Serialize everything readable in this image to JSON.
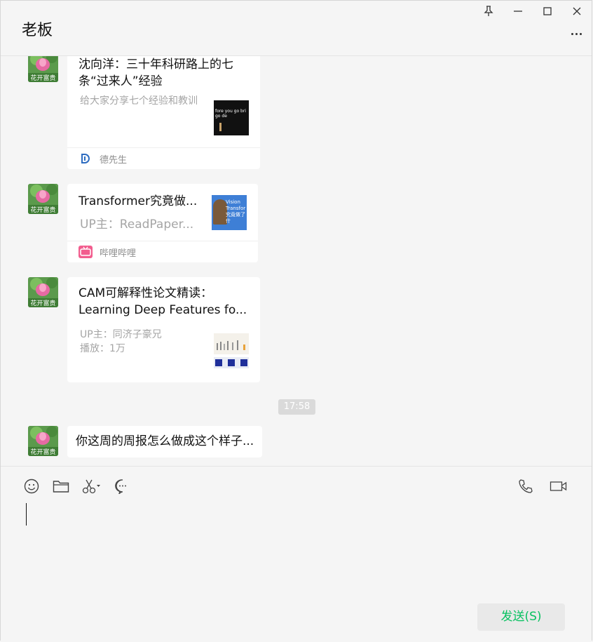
{
  "header": {
    "title": "老板"
  },
  "messages": {
    "card1": {
      "title": "沈向洋：三十年科研路上的七条“过来人”经验",
      "desc": "给大家分享七个经验和教训",
      "thumb_text": "fore you go bri go de",
      "source": "德先生"
    },
    "card2": {
      "title": "Transformer究竟做...",
      "desc": "UP主：ReadPaper...",
      "thumb_text": "Vision Transfor 究竟做了什",
      "source": "哔哩哔哩"
    },
    "card3": {
      "title": "CAM可解释性论文精读：Learning Deep Features fo...",
      "desc_line1": "UP主：同济子豪兄",
      "desc_line2": "播放：1万"
    },
    "time": "17:58",
    "text_message": "你这周的周报怎么做成这个样子..."
  },
  "input": {
    "send_label": "发送(S)"
  },
  "colors": {
    "accent": "#07c160",
    "background": "#f5f5f5"
  }
}
